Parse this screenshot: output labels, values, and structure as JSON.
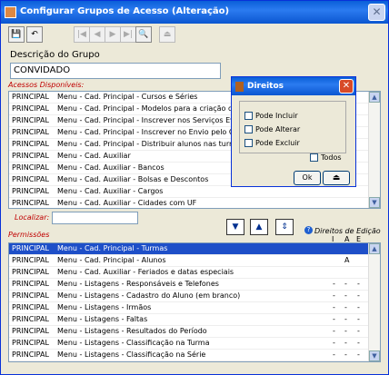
{
  "window": {
    "title": "Configurar Grupos de Acesso (Alteração)",
    "close": "✕"
  },
  "toolbar": {
    "save": "💾",
    "undo": "↶",
    "first": "|◀",
    "prev": "◀",
    "next": "▶",
    "last": "▶|",
    "find": "🔍",
    "exit": "⏏"
  },
  "desc": {
    "label": "Descrição do Grupo",
    "value": "CONVIDADO"
  },
  "available": {
    "label": "Acessos Disponíveis:",
    "rows": [
      [
        "PRINCIPAL",
        "Menu - Cad. Principal - Cursos e Séries"
      ],
      [
        "PRINCIPAL",
        "Menu - Cad. Principal - Modelos para a criação de"
      ],
      [
        "PRINCIPAL",
        "Menu - Cad. Principal - Inscrever nos Serviços Ev"
      ],
      [
        "PRINCIPAL",
        "Menu - Cad. Principal - Inscrever no Envio pelo Co"
      ],
      [
        "PRINCIPAL",
        "Menu - Cad. Principal - Distribuir alunos nas turma"
      ],
      [
        "PRINCIPAL",
        "Menu - Cad. Auxiliar"
      ],
      [
        "PRINCIPAL",
        "Menu - Cad. Auxiliar - Bancos"
      ],
      [
        "PRINCIPAL",
        "Menu - Cad. Auxiliar - Bolsas e Descontos"
      ],
      [
        "PRINCIPAL",
        "Menu - Cad. Auxiliar - Cargos"
      ],
      [
        "PRINCIPAL",
        "Menu - Cad. Auxiliar - Cidades com UF"
      ]
    ]
  },
  "locate": {
    "label": "Localizar:"
  },
  "help": {
    "label": "Direitos de Edição"
  },
  "permissions": {
    "label": "Permissões",
    "headers": [
      "I",
      "A",
      "E"
    ],
    "rows": [
      [
        "PRINCIPAL",
        "Menu - Cad. Principal - Turmas",
        "",
        "",
        ""
      ],
      [
        "PRINCIPAL",
        "Menu - Cad. Principal - Alunos",
        "",
        "A",
        ""
      ],
      [
        "PRINCIPAL",
        "Menu - Cad. Auxiliar - Feriados e datas especiais",
        "",
        "",
        ""
      ],
      [
        "PRINCIPAL",
        "Menu - Listagens - Responsáveis e Telefones",
        "-",
        "-",
        "-"
      ],
      [
        "PRINCIPAL",
        "Menu - Listagens - Cadastro do Aluno (em branco)",
        "-",
        "-",
        "-"
      ],
      [
        "PRINCIPAL",
        "Menu - Listagens - Irmãos",
        "-",
        "-",
        "-"
      ],
      [
        "PRINCIPAL",
        "Menu - Listagens - Faltas",
        "-",
        "-",
        "-"
      ],
      [
        "PRINCIPAL",
        "Menu - Listagens - Resultados do Período",
        "-",
        "-",
        "-"
      ],
      [
        "PRINCIPAL",
        "Menu - Listagens - Classificação na Turma",
        "-",
        "-",
        "-"
      ],
      [
        "PRINCIPAL",
        "Menu - Listagens - Classificação na Série",
        "-",
        "-",
        "-"
      ]
    ]
  },
  "dialog": {
    "title": "Direitos",
    "close": "✕",
    "include": "Pode Incluir",
    "alter": "Pode Alterar",
    "exclude": "Pode Excluir",
    "all": "Todos",
    "ok": "Ok",
    "exit": "⏏"
  },
  "arrows": {
    "down": "▼",
    "up": "▲",
    "swap": "⇕"
  }
}
